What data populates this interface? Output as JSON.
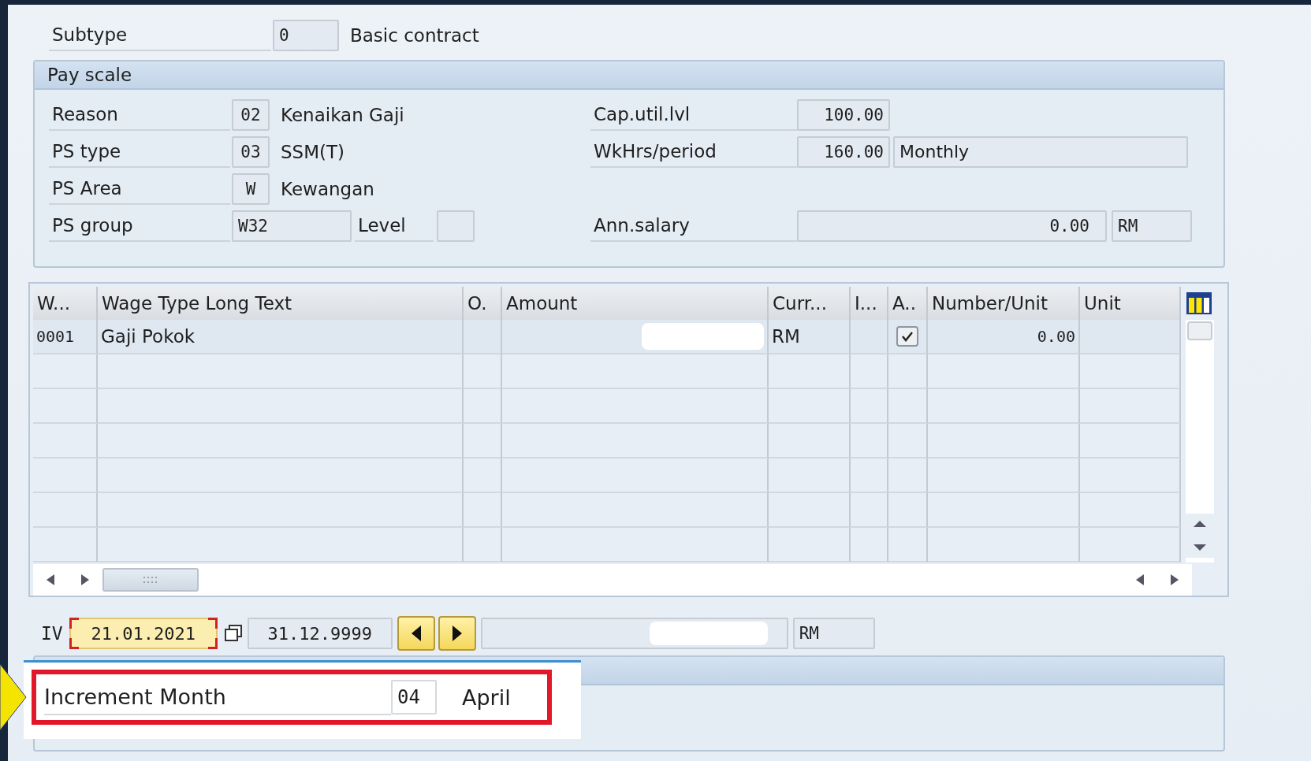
{
  "subtype": {
    "label": "Subtype",
    "value": "0",
    "text": "Basic contract"
  },
  "pay_scale": {
    "title": "Pay scale",
    "rows": [
      {
        "left": {
          "label": "Reason",
          "value": "02",
          "text": "Kenaikan Gaji"
        },
        "right": {
          "label": "Cap.util.lvl",
          "value": "100.00"
        }
      },
      {
        "left": {
          "label": "PS type",
          "value": "03",
          "text": "SSM(T)"
        },
        "right": {
          "label": "WkHrs/period",
          "value": "160.00",
          "period": "Monthly"
        }
      },
      {
        "left": {
          "label": "PS Area",
          "value": "W",
          "text": "Kewangan"
        }
      },
      {
        "left": {
          "label": "PS group",
          "value": "W32",
          "level_label": "Level"
        },
        "right": {
          "label": "Ann.salary",
          "amount": "0.00",
          "currency": "RM"
        }
      }
    ]
  },
  "wage_table": {
    "columns": [
      "W...",
      "Wage Type Long Text",
      "O.",
      "Amount",
      "Curr...",
      "I...",
      "A..",
      "Number/Unit",
      "Unit"
    ],
    "rows": [
      {
        "wage_type": "0001",
        "long_text": "Gaji Pokok",
        "amount_redacted": true,
        "currency": "RM",
        "checked": true,
        "number_unit": "0.00"
      }
    ]
  },
  "validity": {
    "label": "IV",
    "from": "21.01.2021",
    "focused": true,
    "to": "31.12.9999",
    "redacted": true,
    "currency": "RM"
  },
  "increment": {
    "label": "Increment Month",
    "value": "04",
    "text": "April",
    "highlighted": true
  }
}
